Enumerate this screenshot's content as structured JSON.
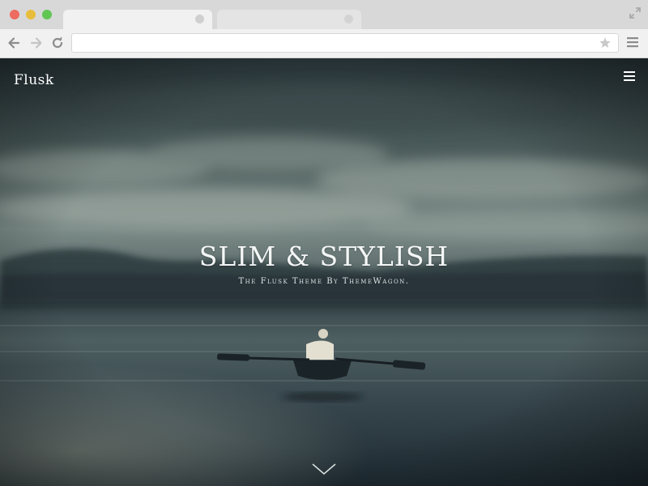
{
  "browser": {
    "icons": {
      "back": "arrow-left-icon",
      "forward": "arrow-right-icon",
      "reload": "reload-icon",
      "bookmark": "star-icon",
      "menu": "hamburger-icon",
      "fullscreen": "resize-icon"
    },
    "address_value": ""
  },
  "site": {
    "logo": "Flusk",
    "menu_icon": "hamburger-icon"
  },
  "hero": {
    "title": "SLIM & STYLISH",
    "subtitle": "The Flusk Theme By ThemeWagon.",
    "scroll_icon": "chevron-down-icon"
  },
  "colors": {
    "window_chrome": "#d8d8d8",
    "toolbar": "#f1f1f1",
    "hero_text": "#f4f6f6"
  }
}
